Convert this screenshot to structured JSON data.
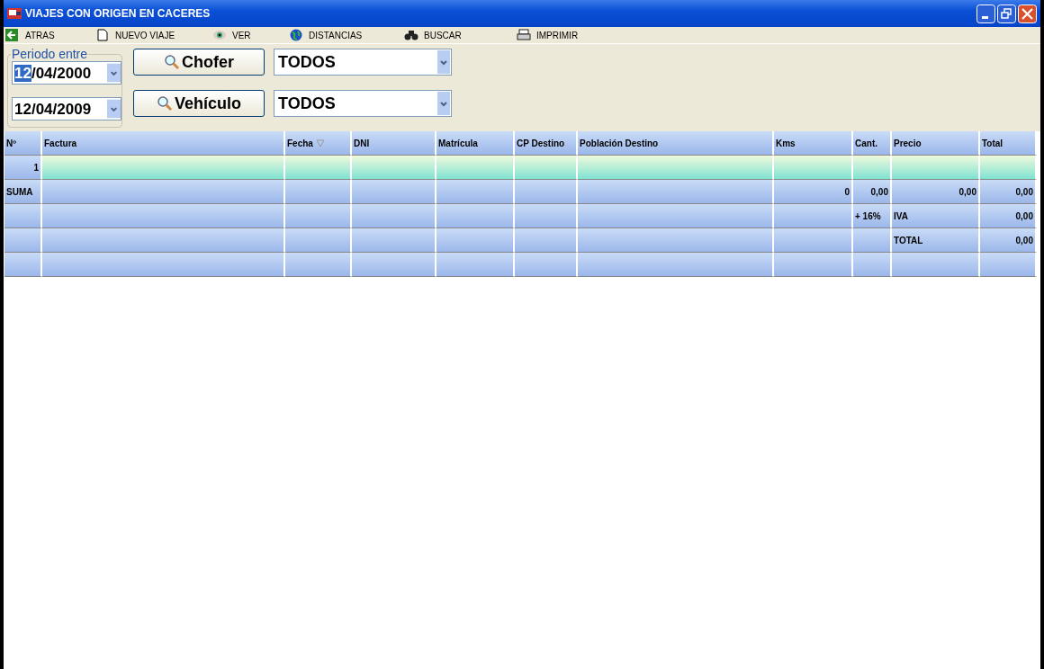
{
  "window": {
    "title": "VIAJES CON ORIGEN EN CACERES"
  },
  "toolbar": [
    "ATRAS",
    "NUEVO VIAJE",
    "VER",
    "DISTANCIAS",
    "BUSCAR",
    "IMPRIMIR"
  ],
  "period": {
    "legend": "Periodo entre",
    "from": {
      "selected_text": "12",
      "text": "/04/2000"
    },
    "to": {
      "text": "12/04/2009"
    }
  },
  "filters": [
    {
      "button": "Chofer",
      "value": "TODOS"
    },
    {
      "button": "Vehículo",
      "value": "TODOS"
    }
  ],
  "table": {
    "columns": [
      {
        "label": "Nº",
        "sorted": false
      },
      {
        "label": "Factura",
        "sorted": false
      },
      {
        "label": "Fecha",
        "sorted": true
      },
      {
        "label": "DNI",
        "sorted": false
      },
      {
        "label": "Matrícula",
        "sorted": false
      },
      {
        "label": "CP Destino",
        "sorted": false
      },
      {
        "label": "Población Destino",
        "sorted": false
      },
      {
        "label": "Kms",
        "sorted": false
      },
      {
        "label": "Cant.",
        "sorted": false
      },
      {
        "label": "Precio",
        "sorted": false
      },
      {
        "label": "Total",
        "sorted": false
      }
    ],
    "rows": [
      {
        "kind": "data",
        "selected": true,
        "cells": [
          {
            "text": "1",
            "kind": "number"
          },
          null,
          null,
          null,
          null,
          null,
          null,
          null,
          null,
          null,
          null
        ]
      },
      {
        "kind": "summary",
        "selected": false,
        "cells": [
          {
            "text": "SUMA",
            "kind": "label"
          },
          null,
          null,
          null,
          null,
          null,
          null,
          {
            "text": "0",
            "kind": "number"
          },
          {
            "text": "0,00",
            "kind": "number"
          },
          {
            "text": "0,00",
            "kind": "number"
          },
          {
            "text": "0,00",
            "kind": "number"
          }
        ]
      },
      {
        "kind": "summary",
        "selected": false,
        "cells": [
          null,
          null,
          null,
          null,
          null,
          null,
          null,
          null,
          {
            "text": "+ 16%",
            "kind": "label"
          },
          {
            "text": "IVA",
            "kind": "label"
          },
          {
            "text": "0,00",
            "kind": "number"
          }
        ]
      },
      {
        "kind": "summary",
        "selected": false,
        "cells": [
          null,
          null,
          null,
          null,
          null,
          null,
          null,
          null,
          null,
          {
            "text": "TOTAL",
            "kind": "label"
          },
          {
            "text": "0,00",
            "kind": "number"
          }
        ]
      },
      {
        "kind": "summary",
        "selected": false,
        "cells": [
          null,
          null,
          null,
          null,
          null,
          null,
          null,
          null,
          null,
          null,
          null
        ]
      }
    ]
  }
}
